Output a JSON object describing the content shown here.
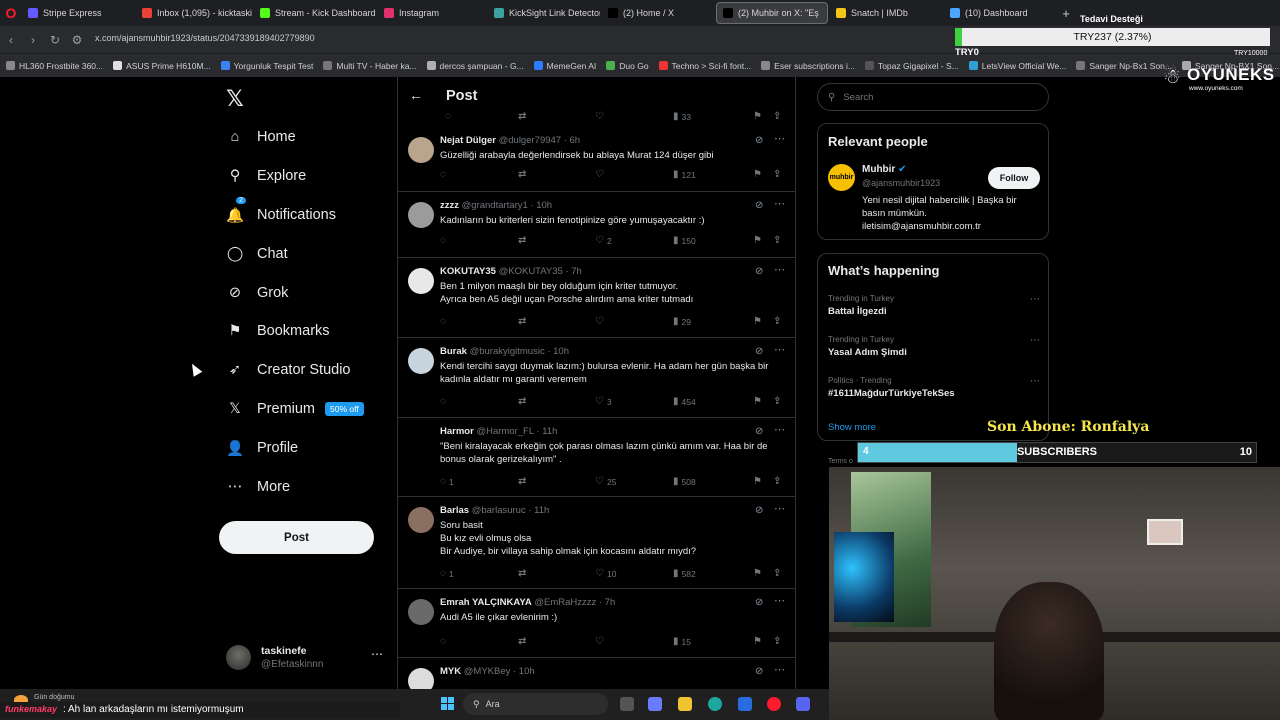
{
  "browser": {
    "tabs": [
      {
        "label": "Stripe Express",
        "color": "#635bff"
      },
      {
        "label": "Inbox (1,095) - kicktaskine",
        "color": "#ea4335"
      },
      {
        "label": "Stream - Kick Dashboard",
        "color": "#53fc18"
      },
      {
        "label": "Instagram",
        "color": "#e1306c"
      },
      {
        "label": "KickSight Link Detector",
        "color": "#3aa0a0"
      },
      {
        "label": "(2) Home / X",
        "color": "#000000"
      },
      {
        "label": "(2) Muhbir on X: \"Eş",
        "color": "#000000"
      },
      {
        "label": "Snatch | IMDb",
        "color": "#f5c518"
      },
      {
        "label": "(10) Dashboard",
        "color": "#4aa6ff"
      }
    ],
    "url": "x.com/ajansmuhbir1923/status/2047339189402779890",
    "bookmarks": [
      "HL360 Frostbite 360...",
      "ASUS Prime H610M...",
      "Yorgunluk Tespit Test",
      "Multi TV - Haber ka...",
      "dercos şampuan - G...",
      "MemeGen AI",
      "Duo Go",
      "Techno > Sci-fi font...",
      "Eser subscriptions i...",
      "Topaz Gigapixel - S...",
      "LetsView Official We...",
      "Sanger Np-Bx1 Son...",
      "Sanger Np-BX1 Son..."
    ]
  },
  "sidebar": {
    "items": [
      {
        "label": "Home",
        "icon": "home-icon",
        "glyph": "⌂"
      },
      {
        "label": "Explore",
        "icon": "search-icon",
        "glyph": "⚲"
      },
      {
        "label": "Notifications",
        "icon": "bell-icon",
        "glyph": "🔔"
      },
      {
        "label": "Chat",
        "icon": "chat-icon",
        "glyph": "◯"
      },
      {
        "label": "Grok",
        "icon": "grok-icon",
        "glyph": "⊘"
      },
      {
        "label": "Bookmarks",
        "icon": "bookmark-icon",
        "glyph": "⚑"
      },
      {
        "label": "Creator Studio",
        "icon": "rocket-icon",
        "glyph": "➶"
      },
      {
        "label": "Premium",
        "icon": "x-icon",
        "glyph": "𝕏"
      },
      {
        "label": "Profile",
        "icon": "person-icon",
        "glyph": "👤"
      },
      {
        "label": "More",
        "icon": "more-icon",
        "glyph": "⋯"
      }
    ],
    "notifications_badge": "2",
    "premium_badge": "50% off",
    "post_label": "Post",
    "account_name": "taskinefe",
    "account_handle": "@Efetaskinnn"
  },
  "center": {
    "title": "Post",
    "top_views": "33",
    "tweets": [
      {
        "name": "Nejat Dülger",
        "handle": "@dulger79947 · 6h",
        "text": "Güzelliği arabayla değerlendirsek  bu ablaya Murat 124 düşer gibi",
        "replies": "",
        "likes": "",
        "views": "121",
        "avatar": "#b9a58b"
      },
      {
        "name": "zzzz",
        "handle": "@grandtartary1 · 10h",
        "text": "Kadınların bu kriterleri sizin fenotipinize göre yumuşayacaktır :)",
        "replies": "",
        "likes": "2",
        "views": "150",
        "avatar": "#9b9b9b"
      },
      {
        "name": "KOKUTAY35",
        "handle": "@KOKUTAY35 · 7h",
        "text": "Ben 1 milyon maaşlı bir bey olduğum için kriter tutmuyor.\nAyrıca ben A5 değil uçan Porsche alırdım ama kriter tutmadı",
        "replies": "",
        "likes": "",
        "views": "29",
        "avatar": "#e8e8e8"
      },
      {
        "name": "Burak",
        "handle": "@burakyigitmusic · 10h",
        "text": "Kendi tercihi saygı duymak lazım:) bulursa evlenir. Ha adam her gün başka bir kadınla aldatır mı garanti veremem",
        "replies": "",
        "likes": "3",
        "views": "454",
        "avatar": "#c8d4de"
      },
      {
        "name": "Harmor",
        "handle": "@Harmor_FL · 11h",
        "text": "\"Beni kiralayacak erkeğin çok parası olması lazım çünkü amım var. Haa bir de bonus olarak gerizekalıyım\" .",
        "replies": "1",
        "likes": "25",
        "views": "508",
        "avatar": "#000000"
      },
      {
        "name": "Barlas",
        "handle": "@barlasuruc · 11h",
        "text": "Soru basit\nBu kız evli olmuş olsa\nBir Audiye, bir villaya sahip olmak için kocasını aldatır mıydı?",
        "replies": "1",
        "likes": "10",
        "views": "582",
        "avatar": "#8a7060"
      },
      {
        "name": "Emrah YALÇINKAYA",
        "handle": "@EmRaHzzzz · 7h",
        "text": "Audi A5 ile çıkar evlenirim :)",
        "replies": "",
        "likes": "",
        "views": "15",
        "avatar": "#6a6a6a"
      },
      {
        "name": "MYK",
        "handle": "@MYKBey · 10h",
        "text": "",
        "replies": "",
        "likes": "",
        "views": "",
        "avatar": "#dcdcdc"
      }
    ]
  },
  "right": {
    "search_placeholder": "Search",
    "relevant_title": "Relevant people",
    "person_name": "Muhbir",
    "person_handle": "@ajansmuhbir1923",
    "person_avatar_text": "muhbir",
    "follow_label": "Follow",
    "person_bio": "Yeni nesil dijital habercilik | Başka bir basın mümkün. iletisim@ajansmuhbir.com.tr",
    "happening_title": "What’s happening",
    "trends": [
      {
        "context": "Trending in Turkey",
        "title": "Battal İlgezdi"
      },
      {
        "context": "Trending in Turkey",
        "title": "Yasal Adım Şimdi"
      },
      {
        "context": "Politics · Trending",
        "title": "#1611MağdurTürkiyeTekSes"
      }
    ],
    "show_more": "Show more",
    "terms": "Terms o"
  },
  "overlay": {
    "donate_title": "Tedavi Desteği",
    "donate_amount": "TRY237 (2.37%)",
    "donate_progress": 0.0237,
    "donate_min": "TRY0",
    "donate_max": "TRY10000",
    "brand": "OYUNEKS",
    "brand_url": "www.oyuneks.com",
    "last_sub": "Son Abone: Ronfalya",
    "sub_current": "4",
    "sub_label": "SUBSCRIBERS",
    "sub_goal": "10",
    "sub_progress": 0.4
  },
  "taskbar": {
    "weather": "Gün doğumu",
    "search_label": "Ara",
    "chat_user": "funkemakay",
    "chat_message": ": Ah lan arkadaşların mı istemiyormuşum"
  }
}
